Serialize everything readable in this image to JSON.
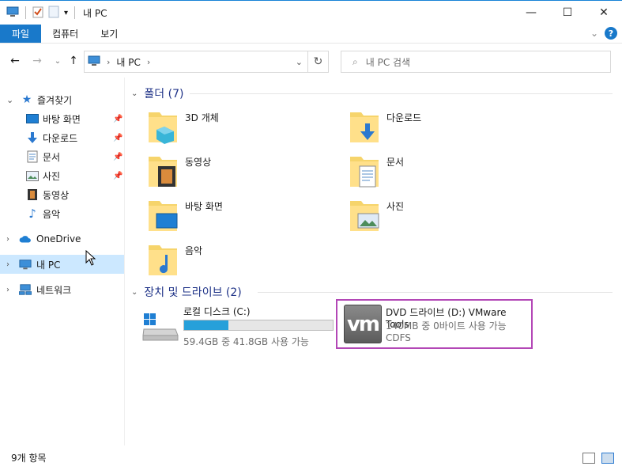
{
  "window": {
    "title": "내 PC",
    "controls": {
      "minimize": "—",
      "maximize": "☐",
      "close": "✕"
    }
  },
  "ribbon": {
    "tabs": [
      "파일",
      "컴퓨터",
      "보기"
    ],
    "help": "?"
  },
  "navbar": {
    "address_crumb": "내 PC",
    "search_placeholder": "내 PC 검색"
  },
  "sidebar": {
    "quick_access": {
      "label": "즐겨찾기",
      "items": [
        {
          "label": "바탕 화면",
          "icon": "desktop-icon",
          "pinned": true
        },
        {
          "label": "다운로드",
          "icon": "download-icon",
          "pinned": true
        },
        {
          "label": "문서",
          "icon": "document-icon",
          "pinned": true
        },
        {
          "label": "사진",
          "icon": "picture-icon",
          "pinned": true
        },
        {
          "label": "동영상",
          "icon": "video-icon",
          "pinned": false
        },
        {
          "label": "음악",
          "icon": "music-icon",
          "pinned": false
        }
      ]
    },
    "onedrive": "OneDrive",
    "this_pc": "내 PC",
    "network": "네트워크"
  },
  "content": {
    "folders_header": "폴더 (7)",
    "folders": [
      {
        "name": "3D 개체",
        "icon": "3d-objects-folder-icon"
      },
      {
        "name": "다운로드",
        "icon": "downloads-folder-icon"
      },
      {
        "name": "동영상",
        "icon": "videos-folder-icon"
      },
      {
        "name": "문서",
        "icon": "documents-folder-icon"
      },
      {
        "name": "바탕 화면",
        "icon": "desktop-folder-icon"
      },
      {
        "name": "사진",
        "icon": "pictures-folder-icon"
      },
      {
        "name": "음악",
        "icon": "music-folder-icon"
      }
    ],
    "drives_header": "장치 및 드라이브 (2)",
    "drives": [
      {
        "name": "로컬 디스크 (C:)",
        "info": "59.4GB 중 41.8GB 사용 가능",
        "used_fraction": 0.3
      },
      {
        "name": "DVD 드라이브 (D:) VMware Tools",
        "info": "140MB 중 0바이트 사용 가능",
        "fs": "CDFS",
        "logo": "vm"
      }
    ]
  },
  "status": {
    "item_count": "9개 항목"
  },
  "colors": {
    "accent": "#1979ca",
    "highlight_border": "#b347b6",
    "selection": "#cce8ff",
    "header_text": "#1e3287"
  }
}
